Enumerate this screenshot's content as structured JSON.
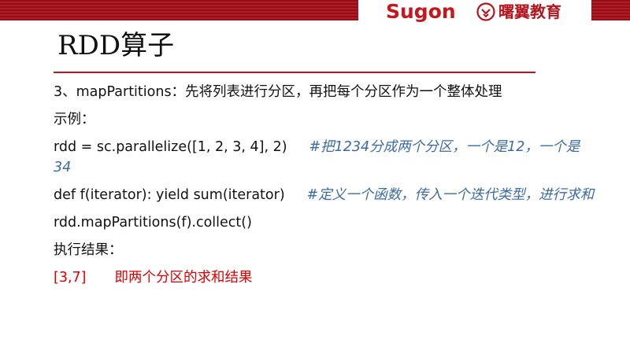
{
  "header": {
    "logo_text": "Sugon",
    "brand_cn": "曙翼教育",
    "emblem_icon": "brand-emblem-icon",
    "accent_color": "#c5121b"
  },
  "slide": {
    "title": "RDD算子",
    "lines": [
      {
        "text": "3、mapPartitions：先将列表进行分区，再把每个分区作为一个整体处理"
      },
      {
        "text": "示例："
      },
      {
        "code": "rdd = sc.parallelize([1, 2, 3, 4], 2)",
        "comment": "#把1234分成两个分区，一个是12，一个是34"
      },
      {
        "code": "def f(iterator): yield sum(iterator)",
        "comment": "#定义一个函数，传入一个迭代类型，进行求和"
      },
      {
        "code": "rdd.mapPartitions(f).collect()"
      },
      {
        "text": "执行结果："
      },
      {
        "result": "[3,7]",
        "explain": "即两个分区的求和结果"
      }
    ]
  }
}
